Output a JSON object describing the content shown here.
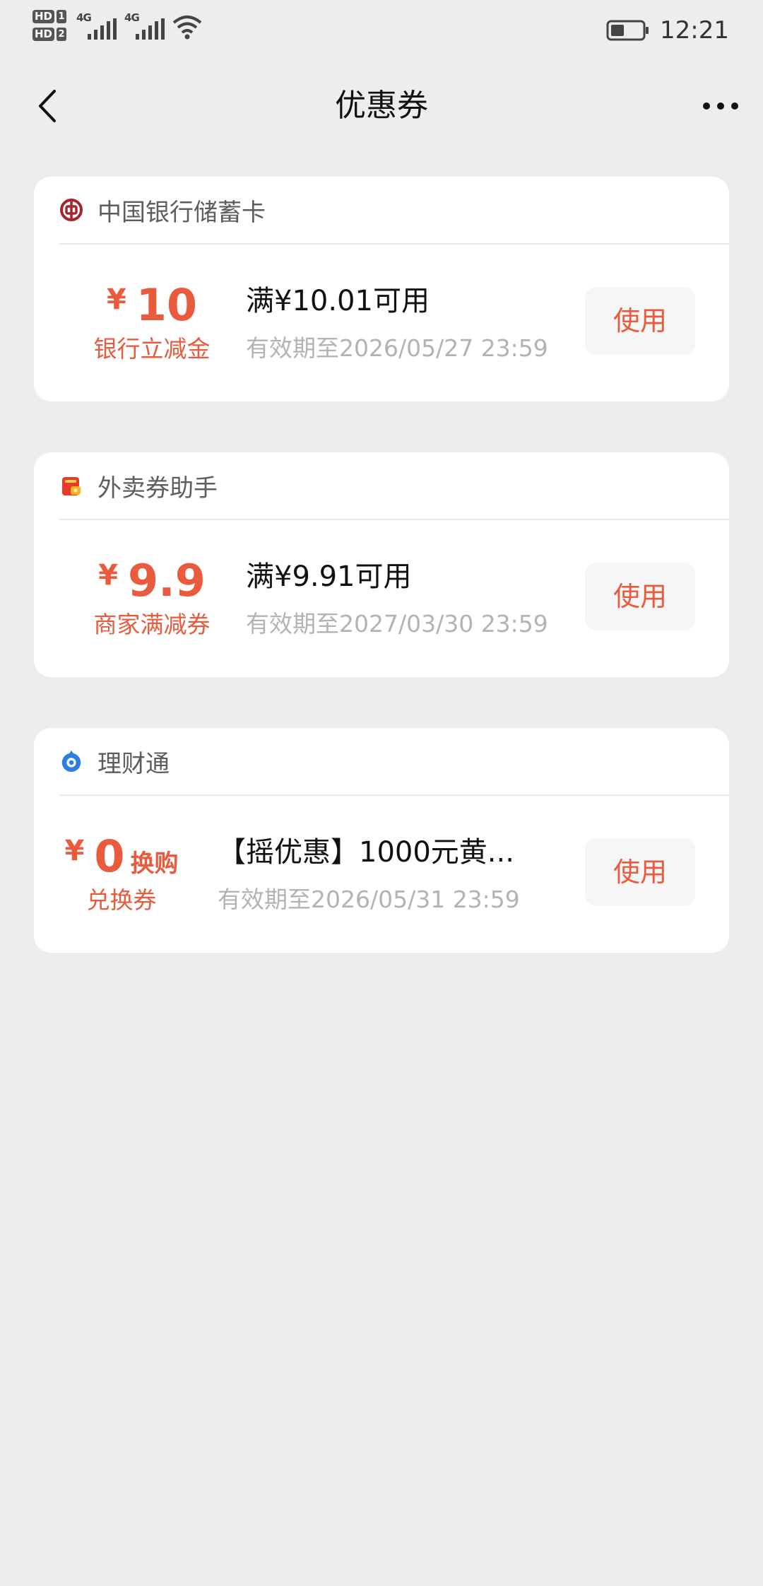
{
  "status_bar": {
    "hd_label": "HD",
    "sim1": "1",
    "sim2": "2",
    "net1": "4G",
    "net2": "4G",
    "time": "12:21"
  },
  "header": {
    "title": "优惠券"
  },
  "coupons": [
    {
      "issuer": "中国银行储蓄卡",
      "issuer_icon": "bank-of-china-icon",
      "currency": "¥",
      "amount": "10",
      "amount_suffix": "",
      "type": "银行立减金",
      "condition": "满¥10.01可用",
      "validity": "有效期至2026/05/27 23:59",
      "button": "使用"
    },
    {
      "issuer": "外卖券助手",
      "issuer_icon": "takeout-coupon-icon",
      "currency": "¥",
      "amount": "9.9",
      "amount_suffix": "",
      "type": "商家满减券",
      "condition": "满¥9.91可用",
      "validity": "有效期至2027/03/30 23:59",
      "button": "使用"
    },
    {
      "issuer": "理财通",
      "issuer_icon": "licaitong-icon",
      "currency": "¥",
      "amount": "0",
      "amount_suffix": "换购",
      "type": "兑换券",
      "condition": "【摇优惠】1000元黄...",
      "validity": "有效期至2026/05/31 23:59",
      "button": "使用"
    }
  ],
  "colors": {
    "accent": "#ea5b3d",
    "background": "#ededed",
    "card": "#ffffff",
    "muted_text": "#b3b3b3"
  }
}
